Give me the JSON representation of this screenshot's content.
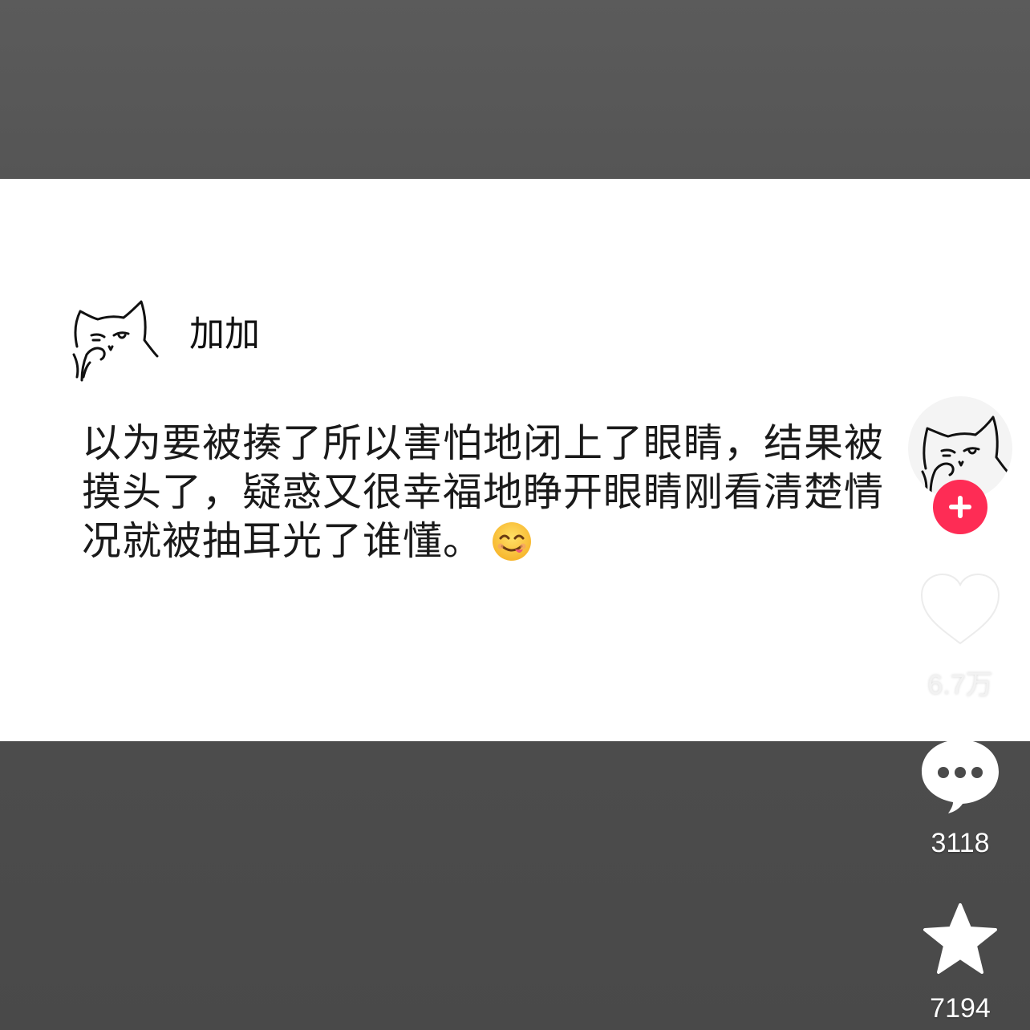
{
  "post": {
    "username": "加加",
    "text": "以为要被揍了所以害怕地闭上了眼睛，结果被摸头了，疑惑又很幸福地睁开眼睛刚看清楚情况就被抽耳光了谁懂。",
    "emoji": "yum-face-emoji"
  },
  "sidebar": {
    "avatar_icon": "cat-sketch-avatar",
    "follow_icon": "plus-icon",
    "follow_color": "#fe2c55",
    "like_count": "6.7万",
    "comment_count": "3118",
    "favorite_count": "7194"
  },
  "colors": {
    "card_background": "#ffffff",
    "backdrop": "#555555"
  }
}
